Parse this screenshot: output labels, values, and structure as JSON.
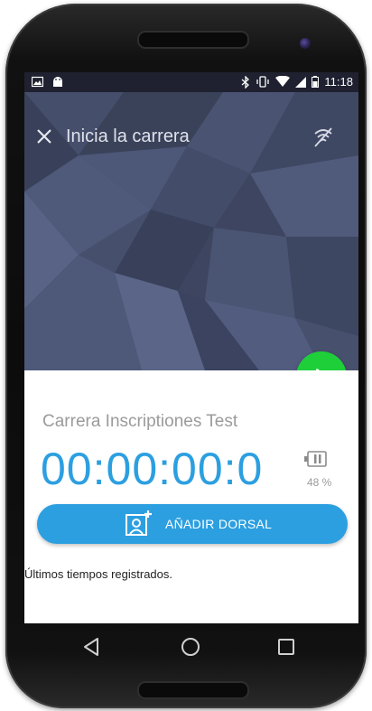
{
  "status_bar": {
    "time": "11:18"
  },
  "toolbar": {
    "close_icon": "close-icon",
    "title": "Inicia la carrera",
    "gps_icon": "gps-off-icon"
  },
  "race": {
    "name": "Carrera Inscriptiones Test",
    "timer": "00:00:00:0",
    "battery_percent": "48 %"
  },
  "actions": {
    "play_icon": "play-icon",
    "add_bib_label": "AÑADIR DORSAL",
    "add_bib_icon": "add-person-icon"
  },
  "list": {
    "header": "Últimos tiempos registrados."
  },
  "colors": {
    "accent_blue": "#2c9fe0",
    "fab_green": "#1fcf3a",
    "hero_bg": "#3d4560"
  }
}
